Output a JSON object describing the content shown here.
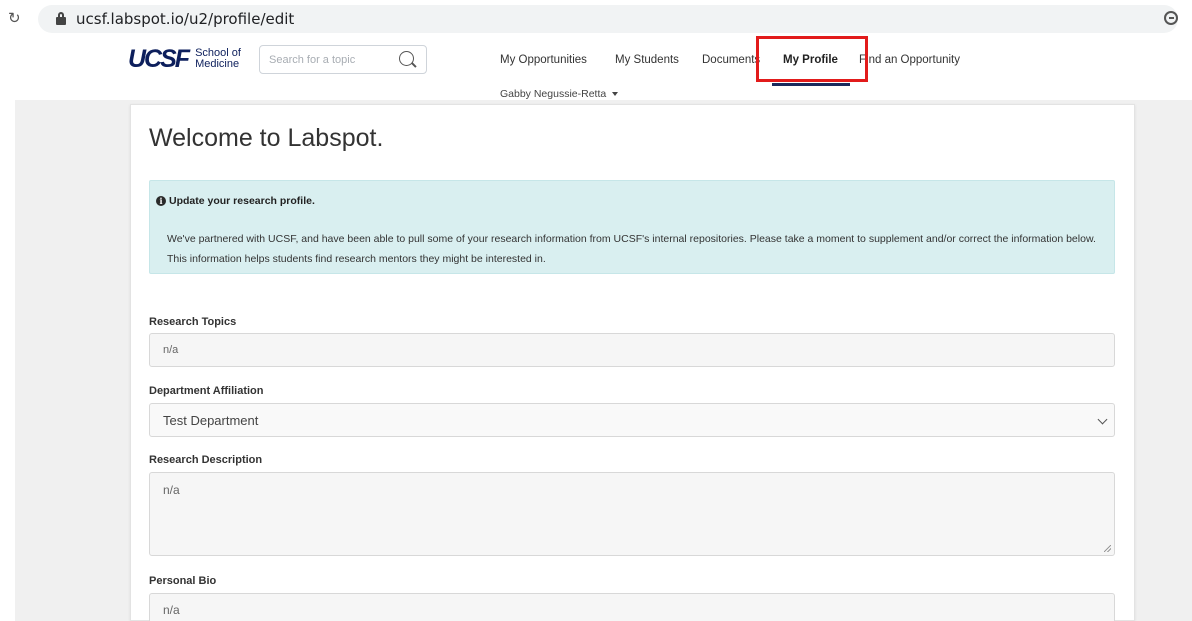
{
  "browser": {
    "reload_glyph": "↻",
    "url": "ucsf.labspot.io/u2/profile/edit"
  },
  "header": {
    "logo_text": "UCSF",
    "logo_subtitle_line1": "School of",
    "logo_subtitle_line2": "Medicine",
    "search_placeholder": "Search for a topic",
    "nav": [
      {
        "label": "My Opportunities",
        "active": false
      },
      {
        "label": "My Students",
        "active": false
      },
      {
        "label": "Documents",
        "active": false
      },
      {
        "label": "My Profile",
        "active": true
      },
      {
        "label": "Find an Opportunity",
        "active": false
      }
    ],
    "user_name": "Gabby Negussie-Retta"
  },
  "main": {
    "title": "Welcome to Labspot.",
    "alert": {
      "heading": "Update your research profile.",
      "body": "We've partnered with UCSF, and have been able to pull some of your research information from UCSF's internal repositories. Please take a moment to supplement and/or correct the information below. This information helps students find research mentors they might be interested in."
    },
    "fields": {
      "research_topics": {
        "label": "Research Topics",
        "value": "n/a"
      },
      "department_affiliation": {
        "label": "Department Affiliation",
        "value": "Test Department"
      },
      "research_description": {
        "label": "Research Description",
        "value": "n/a"
      },
      "personal_bio": {
        "label": "Personal Bio",
        "value": "n/a"
      }
    }
  },
  "colors": {
    "brand_navy": "#0d1f5c",
    "alert_bg": "#d9eff0",
    "highlight_red": "#e21b1b"
  },
  "icons": [
    "reload-icon",
    "lock-icon",
    "zoom-icon",
    "search-icon",
    "caret-down-icon",
    "info-icon",
    "chevron-down-icon",
    "resize-handle-icon"
  ]
}
